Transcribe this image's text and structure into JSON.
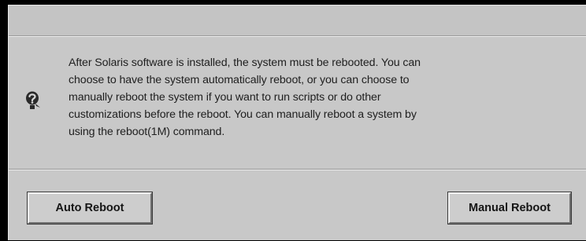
{
  "dialog": {
    "message": "After Solaris software is installed, the system must be rebooted. You can\nchoose to have the system automatically reboot, or you can choose to\nmanually reboot the system if you want to run scripts or do other\ncustomizations before the reboot.  You can manually reboot a system by\nusing the reboot(1M) command.",
    "icon": "question-icon"
  },
  "buttons": {
    "auto_reboot_label": "Auto Reboot",
    "manual_reboot_label": "Manual Reboot"
  },
  "colors": {
    "dialog_background": "#c8c8c8",
    "outer_background": "#000000",
    "text": "#202020"
  }
}
